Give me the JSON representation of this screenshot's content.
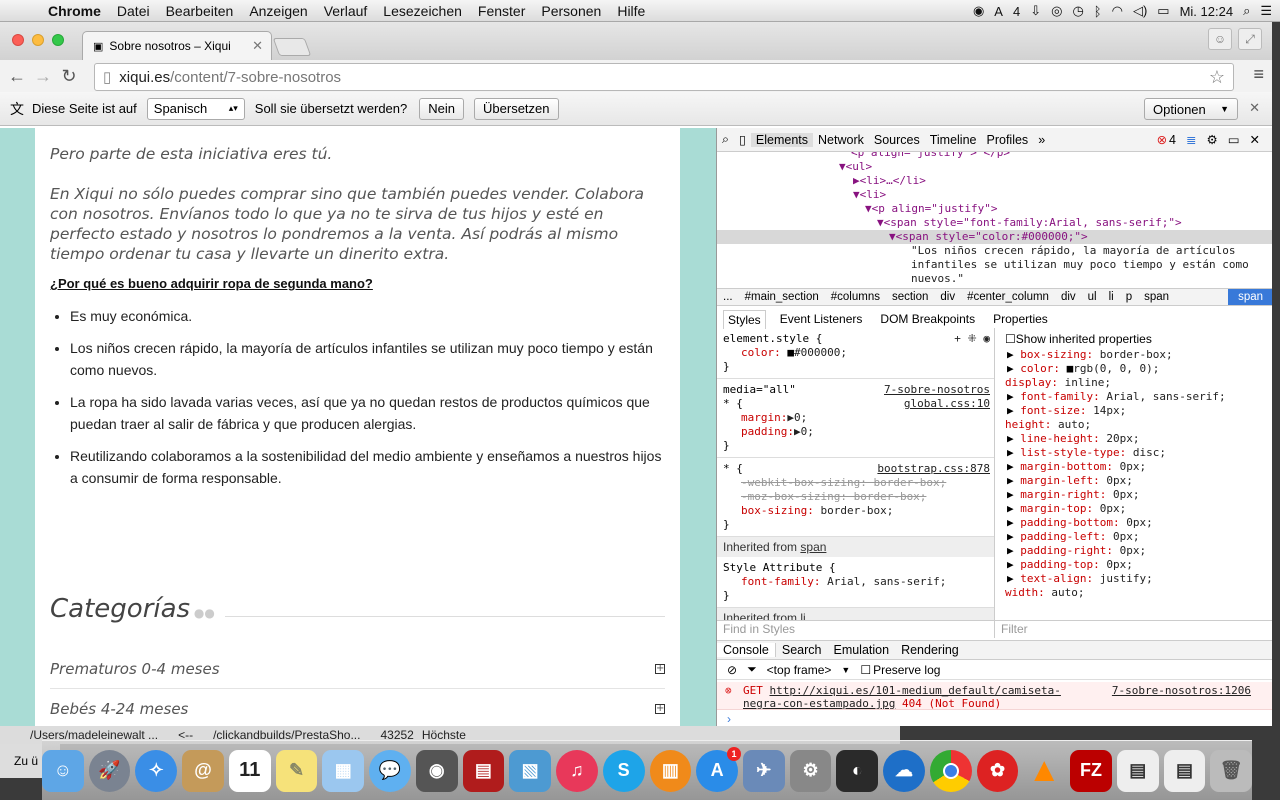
{
  "menubar": {
    "items": [
      "Chrome",
      "Datei",
      "Bearbeiten",
      "Anzeigen",
      "Verlauf",
      "Lesezeichen",
      "Fenster",
      "Personen",
      "Hilfe"
    ],
    "badge_count": "4",
    "clock": "Mi. 12:24"
  },
  "browser": {
    "tab_title": "Sobre nosotros – Xiqui",
    "url_host": "xiqui.es",
    "url_path": "/content/7-sobre-nosotros"
  },
  "translate_bar": {
    "prefix": "Diese Seite ist auf",
    "language": "Spanisch",
    "question": "Soll sie übersetzt werden?",
    "no_label": "Nein",
    "translate_label": "Übersetzen",
    "options_label": "Optionen"
  },
  "page": {
    "intro_line": "Pero parte de esta iniciativa eres tú.",
    "paragraph": "En Xiqui no sólo puedes comprar sino que también puedes vender. Colabora con nosotros. Envíanos todo lo que ya no te sirva de tus hijos y esté en perfecto estado y nosotros lo pondremos a la venta. Así podrás al mismo tiempo ordenar tu casa y llevarte un dinerito extra.",
    "question": "¿Por qué es bueno adquirir ropa de segunda mano?",
    "bullets": [
      "Es muy económica.",
      "Los niños crecen rápido, la mayoría de artículos infantiles se utilizan muy poco tiempo y están como nuevos.",
      "La ropa ha sido lavada varias veces, así que ya no quedan restos de productos químicos que puedan traer al salir de fábrica y que producen alergias.",
      "Reutilizando colaboramos a la sostenibilidad del medio ambiente y enseñamos a nuestros hijos a consumir de forma responsable."
    ],
    "categories_title": "Categorías",
    "categories": [
      "Prematuros 0-4 meses",
      "Bebés 4-24 meses"
    ]
  },
  "devtools": {
    "tabs": [
      "Elements",
      "Network",
      "Sources",
      "Timeline",
      "Profiles"
    ],
    "error_count": "4",
    "dom": {
      "l0": "<p align=\"justify\"> </p>",
      "l1": "<ul>",
      "l2": "<li>…</li>",
      "l3": "<li>",
      "l4": "<p align=\"justify\">",
      "l5": "<span style=\"font-family:Arial, sans-serif;\">",
      "l6": "<span style=\"color:#000000;\">",
      "l7": "\"Los niños crecen rápido, la mayoría de artículos",
      "l8": "infantiles se utilizan muy poco tiempo y están como",
      "l9": "nuevos.\""
    },
    "breadcrumbs": [
      "...",
      "#main_section",
      "#columns",
      "section",
      "div",
      "#center_column",
      "div",
      "ul",
      "li",
      "p",
      "span",
      "span"
    ],
    "style_tabs": [
      "Styles",
      "Event Listeners",
      "DOM Breakpoints",
      "Properties"
    ],
    "styles": {
      "r1_sel": "element.style {",
      "r1_p": "color:",
      "r1_v": "#000000;",
      "r2_media": "media=\"all\"",
      "r2_src1": "7-sobre-nosotros",
      "r2_src2": "global.css:10",
      "r2_sel": "* {",
      "r2_p1": "margin:",
      "r2_v1": "▶0;",
      "r2_p2": "padding:",
      "r2_v2": "▶0;",
      "r3_src": "bootstrap.css:878",
      "r3_sel": "* {",
      "r3_s1": "-webkit-box-sizing: border-box;",
      "r3_s2": "-moz-box-sizing: border-box;",
      "r3_p": "box-sizing:",
      "r3_v": "border-box;",
      "inh1_prefix": "Inherited from",
      "inh1_link": "span",
      "r4_sel": "Style Attribute {",
      "r4_p": "font-family:",
      "r4_v": "Arial, sans-serif;",
      "inh2_prefix": "Inherited from",
      "inh2_link": "li",
      "close": "}"
    },
    "computed": {
      "show_inherited": "Show inherited properties",
      "props": [
        [
          "box-sizing:",
          "border-box;"
        ],
        [
          "color:",
          "rgb(0, 0, 0);"
        ],
        [
          "display:",
          "inline;"
        ],
        [
          "font-family:",
          "Arial, sans-serif;"
        ],
        [
          "font-size:",
          "14px;"
        ],
        [
          "height:",
          "auto;"
        ],
        [
          "line-height:",
          "20px;"
        ],
        [
          "list-style-type:",
          "disc;"
        ],
        [
          "margin-bottom:",
          "0px;"
        ],
        [
          "margin-left:",
          "0px;"
        ],
        [
          "margin-right:",
          "0px;"
        ],
        [
          "margin-top:",
          "0px;"
        ],
        [
          "padding-bottom:",
          "0px;"
        ],
        [
          "padding-left:",
          "0px;"
        ],
        [
          "padding-right:",
          "0px;"
        ],
        [
          "padding-top:",
          "0px;"
        ],
        [
          "text-align:",
          "justify;"
        ],
        [
          "width:",
          "auto;"
        ]
      ]
    },
    "find_placeholder": "Find in Styles",
    "filter_placeholder": "Filter",
    "console_tabs": [
      "Console",
      "Search",
      "Emulation",
      "Rendering"
    ],
    "frame": "<top frame>",
    "preserve_log": "Preserve log",
    "error": {
      "method": "GET",
      "url1": "http://xiqui.es/101-medium_default/camiseta-",
      "url2": "negra-con-estampado.jpg",
      "status": "404 (Not Found)",
      "source": "7-sobre-nosotros:1206"
    }
  },
  "terminal": {
    "path1": "/Users/madeleinewalt ...",
    "arrow": "<--",
    "path2": "/clickandbuilds/PrestaSho...",
    "num": "43252",
    "word": "Höchste",
    "zu": "Zu ü"
  },
  "dock": {
    "calendar_day": "11",
    "appstore_badge": "1",
    "apps": [
      "Finder",
      "Launchpad",
      "Safari",
      "Kontakte",
      "Kalender",
      "Notizen",
      "Vorschau",
      "Nachrichten",
      "FaceTime",
      "Photo Booth",
      "iPhoto",
      "iTunes",
      "Skype",
      "iBooks",
      "App Store",
      "Preview",
      "Systemeinstellungen",
      "Steam",
      "OpenOffice",
      "Chrome",
      "Strawberry",
      "VLC",
      "FileZilla",
      "Dokumente",
      "Dokumente 2",
      "Papierkorb"
    ]
  },
  "colors": {
    "page_bg": "#a9dcd5",
    "crumb_active": "#3879d9",
    "css_prop": "#c80000",
    "error": "#cc0000"
  }
}
